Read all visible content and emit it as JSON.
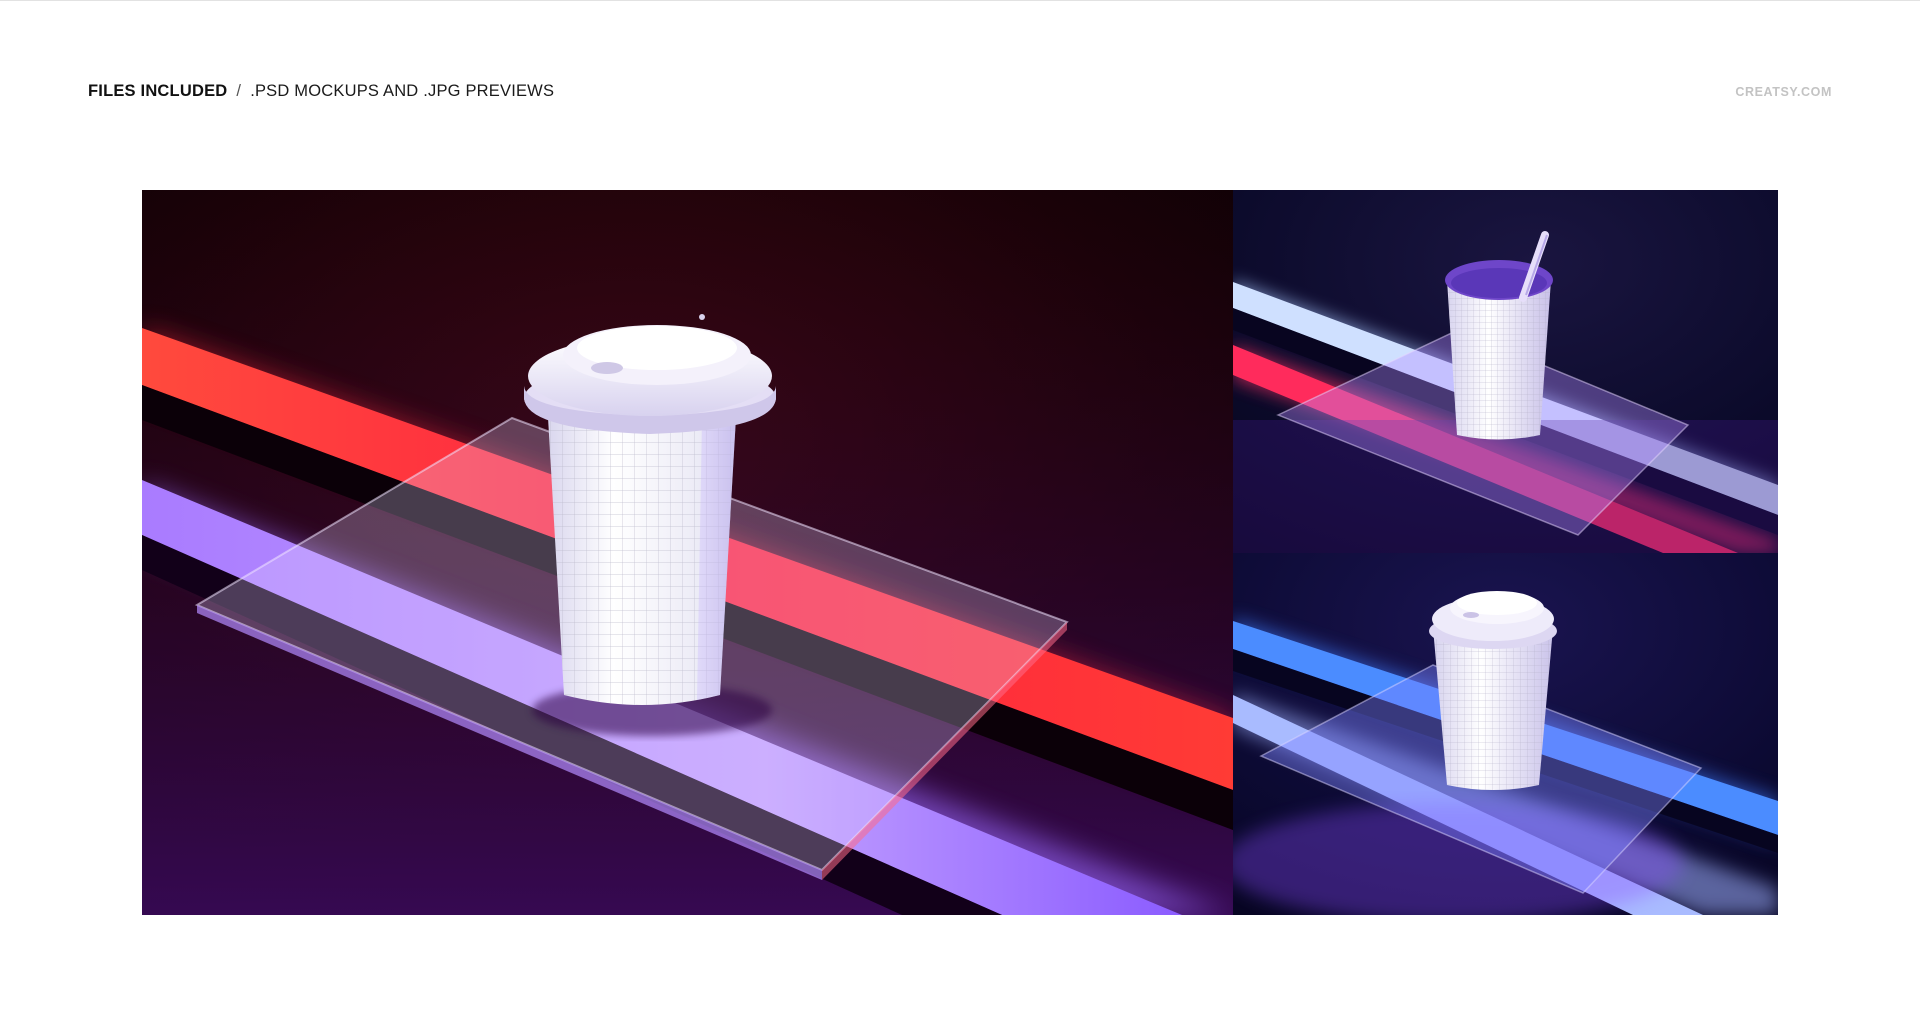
{
  "header": {
    "title": "FILES INCLUDED",
    "separator": "/",
    "subtitle": ".PSD MOCKUPS AND .JPG PREVIEWS",
    "brand": "CREATSY.COM"
  },
  "previews": [
    {
      "subject": "paper-cup-with-lid",
      "accent_colors": [
        "#ff2a3f",
        "#a57bff"
      ]
    },
    {
      "subject": "paper-cup-with-straw",
      "accent_colors": [
        "#ff2d62",
        "#9fd7ff"
      ]
    },
    {
      "subject": "paper-cup-with-lid",
      "accent_colors": [
        "#3f7bff",
        "#9c6bff"
      ]
    }
  ],
  "colors": {
    "background": "#ffffff",
    "text": "#111111",
    "brand": "#c3c3c3"
  }
}
